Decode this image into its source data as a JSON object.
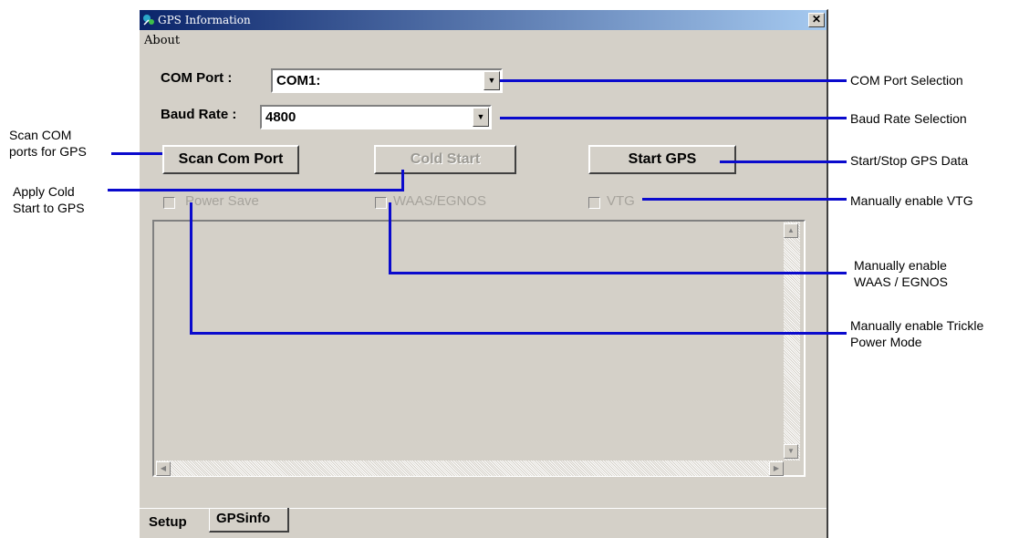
{
  "window": {
    "title": "GPS Information",
    "close_label": "✕",
    "menu": {
      "about": "About"
    }
  },
  "setup": {
    "com_port": {
      "label": "COM Port :",
      "value": "COM1:"
    },
    "baud_rate": {
      "label": "Baud Rate :",
      "value": "4800"
    },
    "buttons": {
      "scan": "Scan Com Port",
      "cold_start": "Cold Start",
      "start_gps": "Start GPS"
    },
    "checkboxes": {
      "power_save": "Power Save",
      "waas": "WAAS/EGNOS",
      "vtg": "VTG"
    }
  },
  "tabs": {
    "setup": "Setup",
    "gpsinfo": "GPSinfo"
  },
  "callouts": {
    "com_port_selection": "COM Port Selection",
    "baud_rate_selection": "Baud Rate Selection",
    "start_stop": "Start/Stop GPS Data",
    "enable_vtg": "Manually enable VTG",
    "enable_waas_1": "Manually enable",
    "enable_waas_2": "WAAS / EGNOS",
    "enable_trickle_1": "Manually enable Trickle",
    "enable_trickle_2": "Power Mode",
    "scan_1": "Scan COM",
    "scan_2": "ports for GPS",
    "cold_1": "Apply Cold",
    "cold_2": "Start to GPS"
  },
  "colors": {
    "line": "#0a0acd",
    "titlebar": "#0a246a",
    "face": "#d4d0c8"
  }
}
